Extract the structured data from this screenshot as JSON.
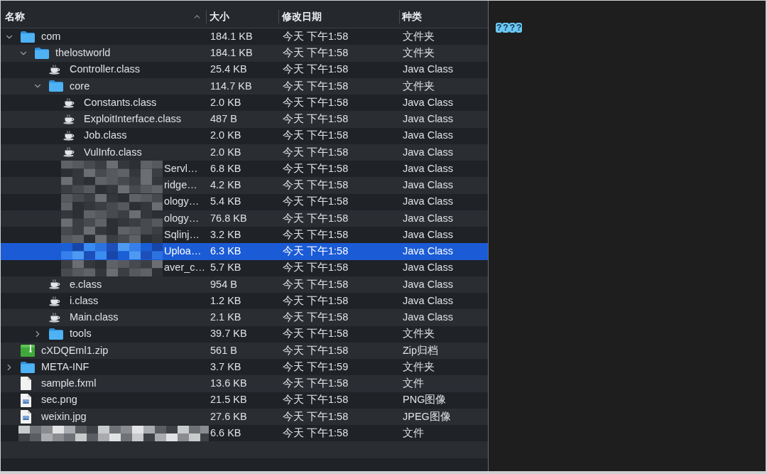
{
  "columns": [
    {
      "label": "名称",
      "sorted": true
    },
    {
      "label": "大小",
      "sorted": false
    },
    {
      "label": "修改日期",
      "sorted": false
    },
    {
      "label": "种类",
      "sorted": false
    }
  ],
  "rows": [
    {
      "kind": "folder",
      "name": "com",
      "size": "184.1 KB",
      "date": "今天 下午1:58",
      "file_type": "文件夹",
      "expanded": true,
      "selected": false,
      "children": [
        {
          "kind": "folder",
          "name": "thelostworld",
          "size": "184.1 KB",
          "date": "今天 下午1:58",
          "file_type": "文件夹",
          "expanded": true,
          "selected": false,
          "children": [
            {
              "kind": "class",
              "name": "Controller.class",
              "size": "25.4 KB",
              "date": "今天 下午1:58",
              "file_type": "Java Class",
              "selected": false
            },
            {
              "kind": "folder",
              "name": "core",
              "size": "114.7 KB",
              "date": "今天 下午1:58",
              "file_type": "文件夹",
              "expanded": true,
              "selected": false,
              "children": [
                {
                  "kind": "class",
                  "name": "Constants.class",
                  "size": "2.0 KB",
                  "date": "今天 下午1:58",
                  "file_type": "Java Class",
                  "selected": false
                },
                {
                  "kind": "class",
                  "name": "ExploitInterface.class",
                  "size": "487 B",
                  "date": "今天 下午1:58",
                  "file_type": "Java Class",
                  "selected": false
                },
                {
                  "kind": "class",
                  "name": "Job.class",
                  "size": "2.0 KB",
                  "date": "今天 下午1:58",
                  "file_type": "Java Class",
                  "selected": false
                },
                {
                  "kind": "class",
                  "name": "VulInfo.class",
                  "size": "2.0 KB",
                  "date": "今天 下午1:58",
                  "file_type": "Java Class",
                  "selected": false
                },
                {
                  "kind": "redacted",
                  "name": "Servl…",
                  "size": "6.8 KB",
                  "date": "今天 下午1:58",
                  "file_type": "Java Class",
                  "selected": false
                },
                {
                  "kind": "redacted",
                  "name": "ridge…",
                  "size": "4.2 KB",
                  "date": "今天 下午1:58",
                  "file_type": "Java Class",
                  "selected": false
                },
                {
                  "kind": "redacted",
                  "name": "ology…",
                  "size": "5.4 KB",
                  "date": "今天 下午1:58",
                  "file_type": "Java Class",
                  "selected": false
                },
                {
                  "kind": "redacted",
                  "name": "ology…",
                  "size": "76.8 KB",
                  "date": "今天 下午1:58",
                  "file_type": "Java Class",
                  "selected": false
                },
                {
                  "kind": "redacted",
                  "name": "Sqlinj…",
                  "size": "3.2 KB",
                  "date": "今天 下午1:58",
                  "file_type": "Java Class",
                  "selected": false
                },
                {
                  "kind": "redacted",
                  "name": "Uploa…",
                  "size": "6.3 KB",
                  "date": "今天 下午1:58",
                  "file_type": "Java Class",
                  "selected": true
                },
                {
                  "kind": "redacted",
                  "name": "aver_c…",
                  "size": "5.7 KB",
                  "date": "今天 下午1:58",
                  "file_type": "Java Class",
                  "selected": false
                }
              ]
            },
            {
              "kind": "class",
              "name": "e.class",
              "size": "954 B",
              "date": "今天 下午1:58",
              "file_type": "Java Class",
              "selected": false
            },
            {
              "kind": "class",
              "name": "i.class",
              "size": "1.2 KB",
              "date": "今天 下午1:58",
              "file_type": "Java Class",
              "selected": false
            },
            {
              "kind": "class",
              "name": "Main.class",
              "size": "2.1 KB",
              "date": "今天 下午1:58",
              "file_type": "Java Class",
              "selected": false
            },
            {
              "kind": "folder",
              "name": "tools",
              "size": "39.7 KB",
              "date": "今天 下午1:58",
              "file_type": "文件夹",
              "expanded": false,
              "selected": false
            }
          ]
        }
      ]
    },
    {
      "kind": "zip",
      "name": "cXDQEml1.zip",
      "size": "561 B",
      "date": "今天 下午1:58",
      "file_type": "Zip归档",
      "selected": false
    },
    {
      "kind": "folder",
      "name": "META-INF",
      "size": "3.7 KB",
      "date": "今天 下午1:59",
      "file_type": "文件夹",
      "expanded": false,
      "selected": false
    },
    {
      "kind": "file",
      "name": "sample.fxml",
      "size": "13.6 KB",
      "date": "今天 下午1:58",
      "file_type": "文件",
      "selected": false
    },
    {
      "kind": "image",
      "name": "sec.png",
      "size": "21.5 KB",
      "date": "今天 下午1:58",
      "file_type": "PNG图像",
      "selected": false
    },
    {
      "kind": "image",
      "name": "weixin.jpg",
      "size": "27.6 KB",
      "date": "今天 下午1:58",
      "file_type": "JPEG图像",
      "selected": false
    },
    {
      "kind": "redacted",
      "size": "6.6 KB",
      "date": "今天 下午1:58",
      "file_type": "文件",
      "selected": false
    }
  ],
  "preview": {
    "text": "????"
  }
}
